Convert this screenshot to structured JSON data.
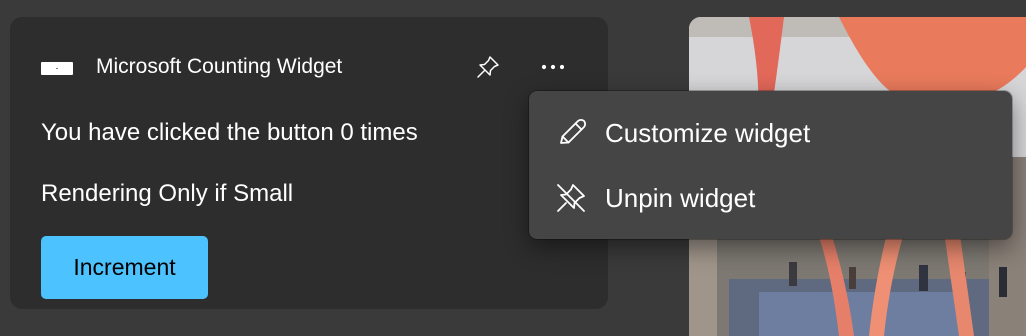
{
  "widget": {
    "title": "Microsoft Counting Widget",
    "click_count_text": "You have clicked the button 0 times",
    "render_mode_text": "Rendering Only if Small",
    "increment_label": "Increment",
    "pin_icon": "pin-icon",
    "more_icon": "more-horizontal-icon",
    "logo_icon": "widget-logo-icon"
  },
  "menu": {
    "items": [
      {
        "label": "Customize widget",
        "icon": "pencil-icon"
      },
      {
        "label": "Unpin widget",
        "icon": "unpin-icon"
      }
    ]
  },
  "colors": {
    "background": "#3a3a3a",
    "card": "#2d2d2d",
    "menu": "#454545",
    "accent": "#4cc2ff",
    "text": "#ffffff"
  }
}
